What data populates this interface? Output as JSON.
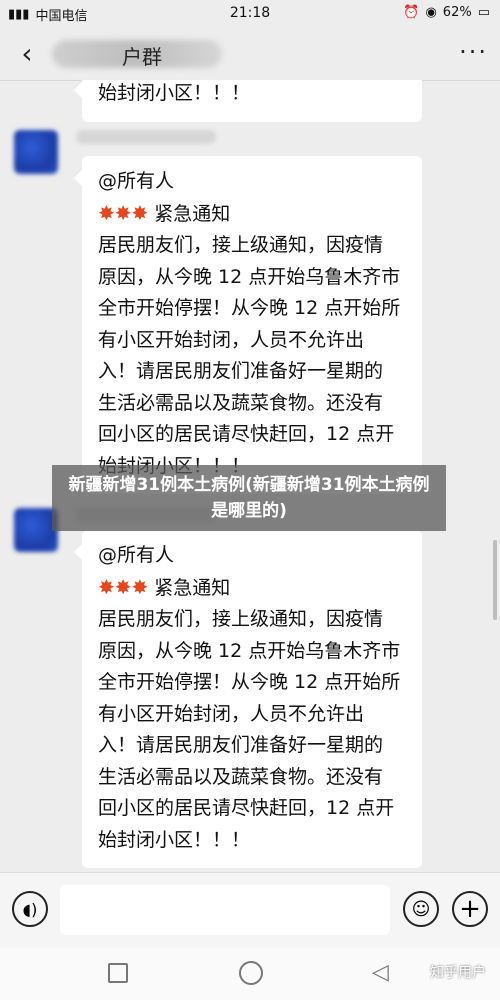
{
  "status_bar": {
    "carrier": "中国电信",
    "time": "21:18",
    "battery": "62%",
    "icons": [
      "signal-icon",
      "alarm-icon",
      "wifi-icon",
      "battery-icon"
    ]
  },
  "header": {
    "title_visible": "户群",
    "back_icon": "back-chevron-icon",
    "more_icon": "more-icon"
  },
  "messages": [
    {
      "lines": [
        "始封闭小区！！！"
      ]
    },
    {
      "lines": [
        "@所有人",
        "紧急通知",
        "居民朋友们，接上级通知，因疫情",
        "原因，从今晚 12 点开始乌鲁木齐市",
        "全市开始停摆！从今晚 12 点开始所",
        "有小区开始封闭，人员不允许出",
        "入！请居民朋友们准备好一星期的",
        "生活必需品以及蔬菜食物。还没有",
        "回小区的居民请尽快赶回，12 点开",
        "始封闭小区！！！"
      ]
    },
    {
      "lines": [
        "@所有人",
        "紧急通知",
        "居民朋友们，接上级通知，因疫情",
        "原因，从今晚 12 点开始乌鲁木齐市",
        "全市开始停摆！从今晚 12 点开始所",
        "有小区开始封闭，人员不允许出",
        "入！请居民朋友们准备好一星期的",
        "生活必需品以及蔬菜食物。还没有",
        "回小区的居民请尽快赶回，12 点开",
        "始封闭小区！！！"
      ]
    }
  ],
  "overlay_caption": "新疆新增31例本土病例(新疆新增31例本土病例是哪里的)",
  "watermark": "知乎用户",
  "colors": {
    "burst": "#e8471d",
    "background": "#ededed",
    "bubble": "#ffffff"
  }
}
